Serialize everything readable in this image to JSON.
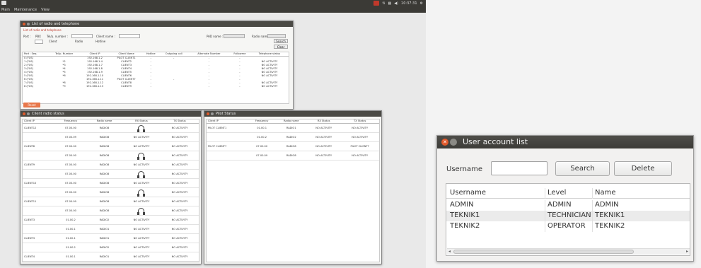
{
  "desktop": {
    "menu": [
      "Main",
      "Maintenance",
      "View"
    ],
    "clock": "10:37:31",
    "list_window": {
      "title": "List of radio and telephone",
      "subtitle": "List of radio and telephone",
      "fields": {
        "port_label": "Port :",
        "tel_label": "Tel/p. number :",
        "client_label": "Client name :",
        "pad_label": "PAD name :",
        "radio_label": "Radio name :",
        "search": "Search",
        "clear": "Clear",
        "opt_pabx": "PBX",
        "opt_client": "Client",
        "opt_radio": "Radio",
        "opt_hotline": "Hotline"
      },
      "columns": [
        "Port : Seq.",
        "Tel/p. Number",
        "Client IP",
        "Client Name",
        "Hotline",
        "Outgoing call",
        "Alternate Number",
        "Followme",
        "Telephone status"
      ],
      "rows": [
        [
          "0 (FXS)",
          "",
          "192.168.1.2",
          "PILOT CLIENT1",
          "-",
          "-",
          "-",
          "-",
          ""
        ],
        [
          "1 (FXS)",
          "*2",
          "192.168.1.4",
          "CLIENT2",
          "-",
          "",
          "-",
          "-",
          "NO ACTIVITY"
        ],
        [
          "2 (FXS)",
          "*3",
          "192.168.1.7",
          "CLIENT3",
          "-",
          "",
          "-",
          "-",
          "NO ACTIVITY"
        ],
        [
          "3 (FXS)",
          "*4",
          "192.168.1.8",
          "CLIENT4",
          "-",
          "",
          "-",
          "-",
          "NO ACTIVITY"
        ],
        [
          "4 (FXS)",
          "*5",
          "192.168.1.9",
          "CLIENT5",
          "-",
          "",
          "-",
          "-",
          "NO ACTIVITY"
        ],
        [
          "5 (FXS)",
          "*6",
          "192.168.1.10",
          "CLIENT6",
          "-",
          "",
          "-",
          "-",
          "NO ACTIVITY"
        ],
        [
          "6 (FXS)",
          "",
          "192.168.1.11",
          "PILOT CLIENT7",
          "-",
          "-",
          "-",
          "-",
          ""
        ],
        [
          "7 (FXS)",
          "*8",
          "192.168.1.12",
          "CLIENT8",
          "-",
          "",
          "-",
          "-",
          "NO ACTIVITY"
        ],
        [
          "8 (FXS)",
          "*9",
          "192.168.1.13",
          "CLIENT9",
          "-",
          "",
          "-",
          "-",
          "NO ACTIVITY"
        ]
      ],
      "reset": "Reset"
    },
    "client_window": {
      "title": "Client radio status",
      "columns": [
        "Client IP",
        "Frequency",
        "Radio name",
        "RX Status",
        "TX Status"
      ],
      "rows": [
        [
          "CLIENT12",
          "07.00.00",
          "RADIO8",
          "hp",
          "NO ACTIVITY"
        ],
        [
          "",
          "07.00.09",
          "RADIO8",
          "NO ACTIVITY",
          "NO ACTIVITY"
        ],
        [
          "CLIENT8",
          "07.00.00",
          "RADIO8",
          "NO ACTIVITY",
          "NO ACTIVITY"
        ],
        [
          "",
          "07.00.00",
          "RADIO8",
          "hp",
          "NO ACTIVITY"
        ],
        [
          "CLIENT9",
          "07.00.00",
          "RADIO8",
          "NO ACTIVITY",
          "NO ACTIVITY"
        ],
        [
          "",
          "07.00.00",
          "RADIO8",
          "hp",
          "NO ACTIVITY"
        ],
        [
          "CLIENT10",
          "07.00.00",
          "RADIO8",
          "NO ACTIVITY",
          "NO ACTIVITY"
        ],
        [
          "",
          "07.00.00",
          "RADIO8",
          "hp",
          "NO ACTIVITY"
        ],
        [
          "CLIENT11",
          "07.00.09",
          "RADIO8",
          "NO ACTIVITY",
          "NO ACTIVITY"
        ],
        [
          "",
          "07.00.00",
          "RADIO8",
          "hp",
          "NO ACTIVITY"
        ],
        [
          "CLIENT3",
          "01.00.2",
          "RADIO2",
          "NO ACTIVITY",
          "NO ACTIVITY"
        ],
        [
          "",
          "01.00.1",
          "RADIO1",
          "NO ACTIVITY",
          "NO ACTIVITY"
        ],
        [
          "CLIENT3",
          "01.00.1",
          "RADIO1",
          "NO ACTIVITY",
          "NO ACTIVITY"
        ],
        [
          "",
          "01.00.2",
          "RADIO2",
          "NO ACTIVITY",
          "NO ACTIVITY"
        ],
        [
          "CLIENT4",
          "01.00.1",
          "RADIO1",
          "NO ACTIVITY",
          "NO ACTIVITY"
        ]
      ]
    },
    "pilot_window": {
      "title": "Pilot Status",
      "columns": [
        "Client IP",
        "Frequency",
        "Radio name",
        "RX Status",
        "TX Status"
      ],
      "rows": [
        [
          "PILOT CLIENT1",
          "01.00.1",
          "RADIO1",
          "NO ACTIVITY",
          "NO ACTIVITY"
        ],
        [
          "",
          "01.00.2",
          "RADIO2",
          "NO ACTIVITY",
          "NO ACTIVITY"
        ],
        [
          "PILOT CLIENT7",
          "07.00.00",
          "RADIO8",
          "NO ACTIVITY",
          "PILOT CLIENT7"
        ],
        [
          "",
          "07.00.09",
          "RADIO8",
          "NO ACTIVITY",
          "NO ACTIVITY"
        ]
      ]
    }
  },
  "dialog": {
    "title": "User account list",
    "username_label": "Username",
    "username_value": "",
    "search": "Search",
    "delete": "Delete",
    "columns": [
      "Username",
      "Level",
      "Name"
    ],
    "rows": [
      [
        "ADMIN",
        "ADMIN",
        "ADMIN"
      ],
      [
        "TEKNIK1",
        "TECHNICIAN",
        "TEKNIK1"
      ],
      [
        "TEKNIK2",
        "OPERATOR",
        "TEKNIK2"
      ]
    ],
    "scroll_left": "◂",
    "scroll_right": "▸"
  }
}
